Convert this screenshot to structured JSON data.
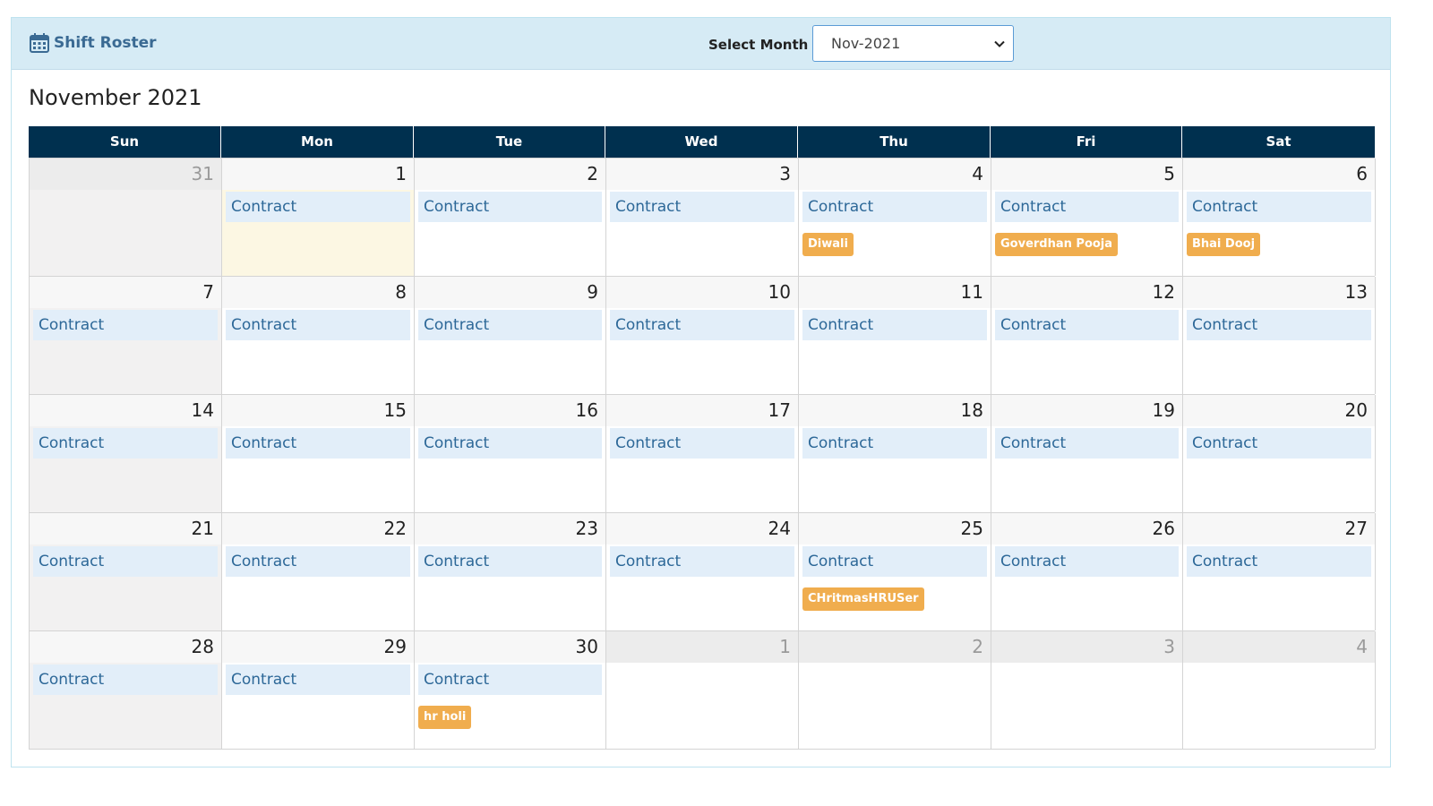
{
  "header": {
    "title": "Shift Roster",
    "select_label": "Select Month",
    "selected_month": "Nov-2021"
  },
  "calendar": {
    "title": "November 2021",
    "weekdays": [
      "Sun",
      "Mon",
      "Tue",
      "Wed",
      "Thu",
      "Fri",
      "Sat"
    ],
    "weeks": [
      [
        {
          "day": "31",
          "other": true,
          "weekend": true,
          "shift": null,
          "holiday": null
        },
        {
          "day": "1",
          "today": true,
          "shift": "Contract",
          "holiday": null
        },
        {
          "day": "2",
          "shift": "Contract",
          "holiday": null
        },
        {
          "day": "3",
          "shift": "Contract",
          "holiday": null
        },
        {
          "day": "4",
          "shift": "Contract",
          "holiday": "Diwali"
        },
        {
          "day": "5",
          "shift": "Contract",
          "holiday": "Goverdhan Pooja"
        },
        {
          "day": "6",
          "shift": "Contract",
          "holiday": "Bhai Dooj"
        }
      ],
      [
        {
          "day": "7",
          "weekend": true,
          "shift": "Contract",
          "holiday": null
        },
        {
          "day": "8",
          "shift": "Contract",
          "holiday": null
        },
        {
          "day": "9",
          "shift": "Contract",
          "holiday": null
        },
        {
          "day": "10",
          "shift": "Contract",
          "holiday": null
        },
        {
          "day": "11",
          "shift": "Contract",
          "holiday": null
        },
        {
          "day": "12",
          "shift": "Contract",
          "holiday": null
        },
        {
          "day": "13",
          "shift": "Contract",
          "holiday": null
        }
      ],
      [
        {
          "day": "14",
          "weekend": true,
          "shift": "Contract",
          "holiday": null
        },
        {
          "day": "15",
          "shift": "Contract",
          "holiday": null
        },
        {
          "day": "16",
          "shift": "Contract",
          "holiday": null
        },
        {
          "day": "17",
          "shift": "Contract",
          "holiday": null
        },
        {
          "day": "18",
          "shift": "Contract",
          "holiday": null
        },
        {
          "day": "19",
          "shift": "Contract",
          "holiday": null
        },
        {
          "day": "20",
          "shift": "Contract",
          "holiday": null
        }
      ],
      [
        {
          "day": "21",
          "weekend": true,
          "shift": "Contract",
          "holiday": null
        },
        {
          "day": "22",
          "shift": "Contract",
          "holiday": null
        },
        {
          "day": "23",
          "shift": "Contract",
          "holiday": null
        },
        {
          "day": "24",
          "shift": "Contract",
          "holiday": null
        },
        {
          "day": "25",
          "shift": "Contract",
          "holiday": "CHritmasHRUSer"
        },
        {
          "day": "26",
          "shift": "Contract",
          "holiday": null
        },
        {
          "day": "27",
          "shift": "Contract",
          "holiday": null
        }
      ],
      [
        {
          "day": "28",
          "weekend": true,
          "shift": "Contract",
          "holiday": null
        },
        {
          "day": "29",
          "shift": "Contract",
          "holiday": null
        },
        {
          "day": "30",
          "shift": "Contract",
          "holiday": "hr holi"
        },
        {
          "day": "1",
          "other": true,
          "shift": null,
          "holiday": null
        },
        {
          "day": "2",
          "other": true,
          "shift": null,
          "holiday": null
        },
        {
          "day": "3",
          "other": true,
          "shift": null,
          "holiday": null
        },
        {
          "day": "4",
          "other": true,
          "shift": null,
          "holiday": null
        }
      ]
    ]
  },
  "colors": {
    "header_bg": "#d6ebf5",
    "weekday_bar": "#00304f",
    "shift_bg": "#e2eef9",
    "shift_text": "#2d6898",
    "holiday_badge": "#f0ad4e",
    "today_bg": "#fcf7e3"
  },
  "icons": {
    "brand": "calendar-icon",
    "select": "chevron-down-icon"
  }
}
